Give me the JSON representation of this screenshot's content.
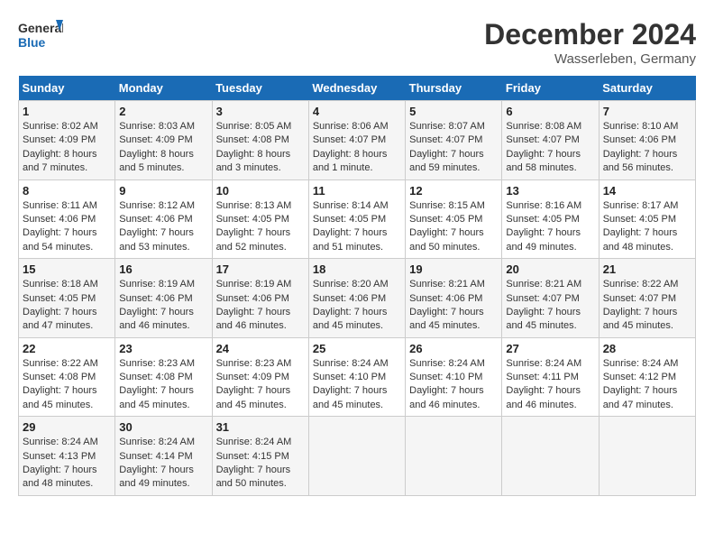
{
  "header": {
    "logo_line1": "General",
    "logo_line2": "Blue",
    "month": "December 2024",
    "location": "Wasserleben, Germany"
  },
  "weekdays": [
    "Sunday",
    "Monday",
    "Tuesday",
    "Wednesday",
    "Thursday",
    "Friday",
    "Saturday"
  ],
  "weeks": [
    [
      {
        "day": "1",
        "sunrise": "8:02 AM",
        "sunset": "4:09 PM",
        "daylight": "8 hours and 7 minutes."
      },
      {
        "day": "2",
        "sunrise": "8:03 AM",
        "sunset": "4:09 PM",
        "daylight": "8 hours and 5 minutes."
      },
      {
        "day": "3",
        "sunrise": "8:05 AM",
        "sunset": "4:08 PM",
        "daylight": "8 hours and 3 minutes."
      },
      {
        "day": "4",
        "sunrise": "8:06 AM",
        "sunset": "4:07 PM",
        "daylight": "8 hours and 1 minute."
      },
      {
        "day": "5",
        "sunrise": "8:07 AM",
        "sunset": "4:07 PM",
        "daylight": "7 hours and 59 minutes."
      },
      {
        "day": "6",
        "sunrise": "8:08 AM",
        "sunset": "4:07 PM",
        "daylight": "7 hours and 58 minutes."
      },
      {
        "day": "7",
        "sunrise": "8:10 AM",
        "sunset": "4:06 PM",
        "daylight": "7 hours and 56 minutes."
      }
    ],
    [
      {
        "day": "8",
        "sunrise": "8:11 AM",
        "sunset": "4:06 PM",
        "daylight": "7 hours and 54 minutes."
      },
      {
        "day": "9",
        "sunrise": "8:12 AM",
        "sunset": "4:06 PM",
        "daylight": "7 hours and 53 minutes."
      },
      {
        "day": "10",
        "sunrise": "8:13 AM",
        "sunset": "4:05 PM",
        "daylight": "7 hours and 52 minutes."
      },
      {
        "day": "11",
        "sunrise": "8:14 AM",
        "sunset": "4:05 PM",
        "daylight": "7 hours and 51 minutes."
      },
      {
        "day": "12",
        "sunrise": "8:15 AM",
        "sunset": "4:05 PM",
        "daylight": "7 hours and 50 minutes."
      },
      {
        "day": "13",
        "sunrise": "8:16 AM",
        "sunset": "4:05 PM",
        "daylight": "7 hours and 49 minutes."
      },
      {
        "day": "14",
        "sunrise": "8:17 AM",
        "sunset": "4:05 PM",
        "daylight": "7 hours and 48 minutes."
      }
    ],
    [
      {
        "day": "15",
        "sunrise": "8:18 AM",
        "sunset": "4:05 PM",
        "daylight": "7 hours and 47 minutes."
      },
      {
        "day": "16",
        "sunrise": "8:19 AM",
        "sunset": "4:06 PM",
        "daylight": "7 hours and 46 minutes."
      },
      {
        "day": "17",
        "sunrise": "8:19 AM",
        "sunset": "4:06 PM",
        "daylight": "7 hours and 46 minutes."
      },
      {
        "day": "18",
        "sunrise": "8:20 AM",
        "sunset": "4:06 PM",
        "daylight": "7 hours and 45 minutes."
      },
      {
        "day": "19",
        "sunrise": "8:21 AM",
        "sunset": "4:06 PM",
        "daylight": "7 hours and 45 minutes."
      },
      {
        "day": "20",
        "sunrise": "8:21 AM",
        "sunset": "4:07 PM",
        "daylight": "7 hours and 45 minutes."
      },
      {
        "day": "21",
        "sunrise": "8:22 AM",
        "sunset": "4:07 PM",
        "daylight": "7 hours and 45 minutes."
      }
    ],
    [
      {
        "day": "22",
        "sunrise": "8:22 AM",
        "sunset": "4:08 PM",
        "daylight": "7 hours and 45 minutes."
      },
      {
        "day": "23",
        "sunrise": "8:23 AM",
        "sunset": "4:08 PM",
        "daylight": "7 hours and 45 minutes."
      },
      {
        "day": "24",
        "sunrise": "8:23 AM",
        "sunset": "4:09 PM",
        "daylight": "7 hours and 45 minutes."
      },
      {
        "day": "25",
        "sunrise": "8:24 AM",
        "sunset": "4:10 PM",
        "daylight": "7 hours and 45 minutes."
      },
      {
        "day": "26",
        "sunrise": "8:24 AM",
        "sunset": "4:10 PM",
        "daylight": "7 hours and 46 minutes."
      },
      {
        "day": "27",
        "sunrise": "8:24 AM",
        "sunset": "4:11 PM",
        "daylight": "7 hours and 46 minutes."
      },
      {
        "day": "28",
        "sunrise": "8:24 AM",
        "sunset": "4:12 PM",
        "daylight": "7 hours and 47 minutes."
      }
    ],
    [
      {
        "day": "29",
        "sunrise": "8:24 AM",
        "sunset": "4:13 PM",
        "daylight": "7 hours and 48 minutes."
      },
      {
        "day": "30",
        "sunrise": "8:24 AM",
        "sunset": "4:14 PM",
        "daylight": "7 hours and 49 minutes."
      },
      {
        "day": "31",
        "sunrise": "8:24 AM",
        "sunset": "4:15 PM",
        "daylight": "7 hours and 50 minutes."
      },
      null,
      null,
      null,
      null
    ]
  ]
}
